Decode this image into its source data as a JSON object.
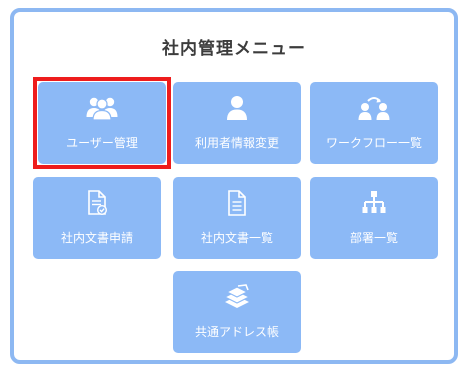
{
  "menu": {
    "title": "社内管理メニュー",
    "items": [
      {
        "label": "ユーザー管理",
        "icon": "users-icon",
        "selected": true
      },
      {
        "label": "利用者情報変更",
        "icon": "user-icon",
        "selected": false
      },
      {
        "label": "ワークフロー一覧",
        "icon": "workflow-icon",
        "selected": false
      },
      {
        "label": "社内文書申請",
        "icon": "document-check-icon",
        "selected": false
      },
      {
        "label": "社内文書一覧",
        "icon": "document-icon",
        "selected": false
      },
      {
        "label": "部署一覧",
        "icon": "org-chart-icon",
        "selected": false
      },
      {
        "label": "共通アドレス帳",
        "icon": "address-book-stack-icon",
        "selected": false
      }
    ]
  },
  "colors": {
    "panel_border": "#8db8f2",
    "tile_background": "#8cb9f6",
    "selection_outline": "#ee1c1c"
  }
}
